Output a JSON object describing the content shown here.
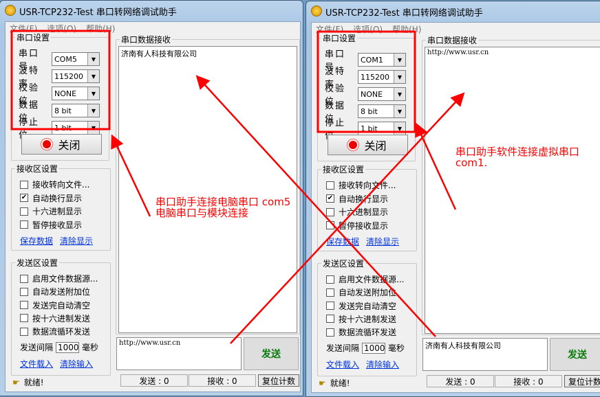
{
  "windows": [
    {
      "title": "USR-TCP232-Test 串口转网络调试助手",
      "menu": [
        "文件(F)",
        "选项(O)",
        "帮助(H)"
      ],
      "serial_group": "串口设置",
      "settings": [
        {
          "label": "串口号",
          "value": "COM5"
        },
        {
          "label": "波特率",
          "value": "115200"
        },
        {
          "label": "校验位",
          "value": "NONE"
        },
        {
          "label": "数据位",
          "value": "8 bit"
        },
        {
          "label": "停止位",
          "value": "1 bit"
        }
      ],
      "open_button": "关闭",
      "recv_group": "接收区设置",
      "recv_options": [
        {
          "label": "接收转向文件...",
          "checked": false
        },
        {
          "label": "自动换行显示",
          "checked": true
        },
        {
          "label": "十六进制显示",
          "checked": false
        },
        {
          "label": "暂停接收显示",
          "checked": false
        }
      ],
      "recv_links": [
        "保存数据",
        "清除显示"
      ],
      "send_group": "发送区设置",
      "send_options": [
        {
          "label": "启用文件数据源...",
          "checked": false
        },
        {
          "label": "自动发送附加位",
          "checked": false
        },
        {
          "label": "发送完自动清空",
          "checked": false
        },
        {
          "label": "按十六进制发送",
          "checked": false
        },
        {
          "label": "数据流循环发送",
          "checked": false
        }
      ],
      "interval_label": "发送间隔",
      "interval_value": "1000",
      "interval_unit": "毫秒",
      "send_links": [
        "文件载入",
        "清除输入"
      ],
      "recv_title": "串口数据接收",
      "recv_text": "济南有人科技有限公司",
      "send_text": "http://www.usr.cn",
      "send_button": "发送",
      "status": "就绪!",
      "sent": "发送 : 0",
      "received": "接收 : 0",
      "reset": "复位计数"
    },
    {
      "title": "USR-TCP232-Test 串口转网络调试助手",
      "menu": [
        "文件(F)",
        "选项(O)",
        "帮助(H)"
      ],
      "serial_group": "串口设置",
      "settings": [
        {
          "label": "串口号",
          "value": "COM1"
        },
        {
          "label": "波特率",
          "value": "115200"
        },
        {
          "label": "校验位",
          "value": "NONE"
        },
        {
          "label": "数据位",
          "value": "8 bit"
        },
        {
          "label": "停止位",
          "value": "1 bit"
        }
      ],
      "open_button": "关闭",
      "recv_group": "接收区设置",
      "recv_options": [
        {
          "label": "接收转向文件...",
          "checked": false
        },
        {
          "label": "自动换行显示",
          "checked": true
        },
        {
          "label": "十六进制显示",
          "checked": false
        },
        {
          "label": "暂停接收显示",
          "checked": false
        }
      ],
      "recv_links": [
        "保存数据",
        "清除显示"
      ],
      "send_group": "发送区设置",
      "send_options": [
        {
          "label": "启用文件数据源...",
          "checked": false
        },
        {
          "label": "自动发送附加位",
          "checked": false
        },
        {
          "label": "发送完自动清空",
          "checked": false
        },
        {
          "label": "按十六进制发送",
          "checked": false
        },
        {
          "label": "数据流循环发送",
          "checked": false
        }
      ],
      "interval_label": "发送间隔",
      "interval_value": "1000",
      "interval_unit": "毫秒",
      "send_links": [
        "文件载入",
        "清除输入"
      ],
      "recv_title": "串口数据接收",
      "recv_text": "http://www.usr.cn",
      "send_text": "济南有人科技有限公司",
      "send_button": "发送",
      "status": "就绪!",
      "sent": "发送 : 0",
      "received": "接收 : 0",
      "reset": "复位计数"
    }
  ],
  "annotations": {
    "left_note": "串口助手连接电脑串口 com5\n电脑串口与模块连接",
    "right_note": "串口助手软件连接虚拟串口\ncom1.",
    "color": "#ff0000"
  }
}
